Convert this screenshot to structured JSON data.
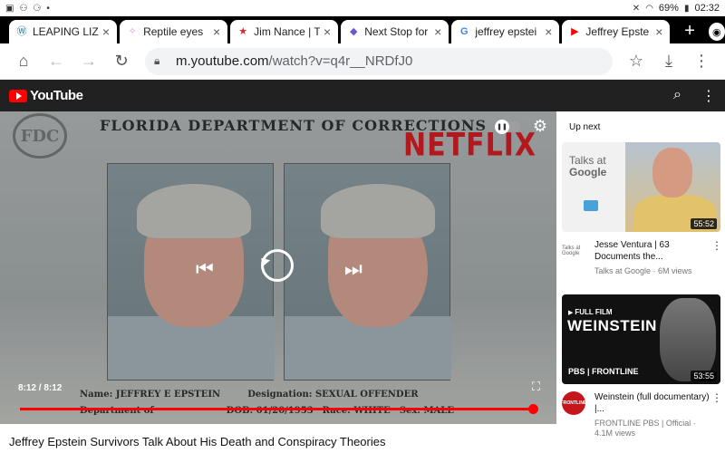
{
  "status_bar": {
    "battery": "69%",
    "time": "02:32"
  },
  "tabs": [
    {
      "title": "LEAPING LIZA",
      "favicon": "wordpress-icon"
    },
    {
      "title": "Reptile eyes",
      "favicon": "sparkle-icon"
    },
    {
      "title": "Jim Nance | T",
      "favicon": "star-icon"
    },
    {
      "title": "Next Stop for",
      "favicon": "bookmark-icon"
    },
    {
      "title": "jeffrey epstei",
      "favicon": "google-icon"
    },
    {
      "title": "Jeffrey Epste",
      "favicon": "youtube-icon"
    }
  ],
  "toolbar": {
    "url_host": "m.youtube.com",
    "url_path": "/watch?v=q4r__NRDfJ0"
  },
  "youtube": {
    "logo_text": "YouTube"
  },
  "player": {
    "doc_title": "FLORIDA DEPARTMENT OF CORRECTIONS",
    "seal_text": "FDC",
    "watermark": "NETFLIX",
    "name_label": "Name: JEFFREY E EPSTEIN",
    "designation_label": "Designation: SEXUAL OFFENDER",
    "dept_label": "Department of",
    "dob_label": "DOB: 01/20/1953",
    "race_label": "Race: WHITE",
    "sex_label": "Sex: MALE",
    "time_display": "8:12 / 8:12",
    "progress_fraction": 1.0
  },
  "video": {
    "title": "Jeffrey Epstein Survivors Talk About His Death and Conspiracy Theories"
  },
  "sidebar": {
    "up_next_label": "Up next",
    "cards": [
      {
        "title": "Jesse Ventura | 63 Documents the...",
        "channel": "Talks at Google",
        "views": "6M views",
        "duration": "55:52",
        "thumb_talks": "Talks at",
        "thumb_google": "Google",
        "avatar_text": "Talks at Google"
      },
      {
        "title": "Weinstein (full documentary) |...",
        "channel": "FRONTLINE PBS | Official",
        "views": "4.1M views",
        "duration": "53:55",
        "thumb_tag": "FULL FILM",
        "thumb_title": "WEINSTEIN",
        "thumb_pbs": "PBS | FRONTLINE",
        "avatar_text": "FRONTLINE"
      }
    ]
  }
}
